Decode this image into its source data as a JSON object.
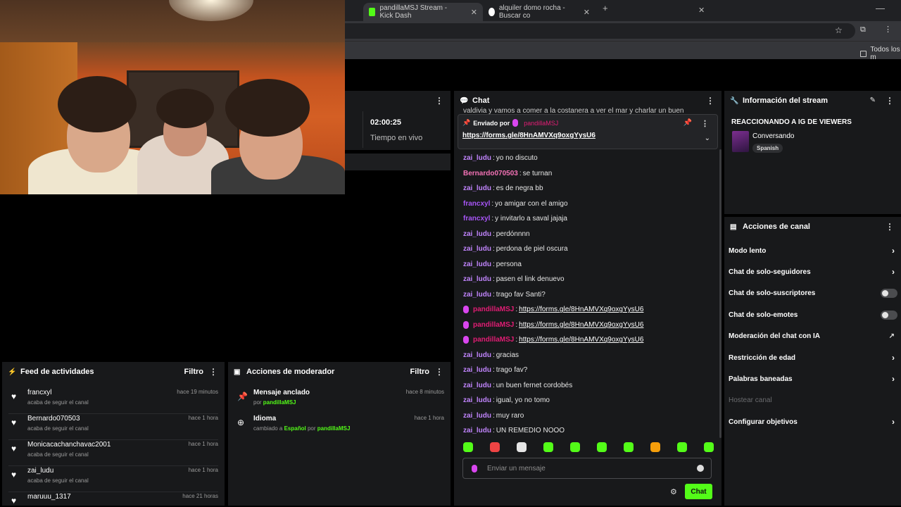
{
  "browser": {
    "tabs": [
      {
        "title": "pandillaMSJ Stream - Kick Dash",
        "active": true
      },
      {
        "title": "alquiler domo rocha - Buscar co",
        "active": false
      }
    ],
    "bookmark_all": "Todos los m"
  },
  "stats": {
    "time": "02:00:25",
    "time_label": "Tiempo en vivo"
  },
  "chat": {
    "title": "Chat",
    "overflow_line": "valdivia y vamos a comer a la costanera a ver el mar y charlar un buen",
    "pinned": {
      "label": "Enviado por",
      "user": "pandillaMSJ",
      "link": "https://forms.gle/8HnAMVXq9oxgYysU6"
    },
    "messages": [
      {
        "user": "zai_ludu",
        "color": "#c084fc",
        "text": "yo no discuto"
      },
      {
        "user": "Bernardo070503",
        "color": "#f472b6",
        "text": "se turnan"
      },
      {
        "user": "zai_ludu",
        "color": "#c084fc",
        "text": "es de negra bb"
      },
      {
        "user": "francxyl",
        "color": "#a855f7",
        "text": "yo amigar con el amigo"
      },
      {
        "user": "francxyl",
        "color": "#a855f7",
        "text": "y invitarlo a saval jajaja"
      },
      {
        "user": "zai_ludu",
        "color": "#c084fc",
        "text": "perdónnnn"
      },
      {
        "user": "zai_ludu",
        "color": "#c084fc",
        "text": "perdona de piel oscura"
      },
      {
        "user": "zai_ludu",
        "color": "#c084fc",
        "text": "persona"
      },
      {
        "user": "zai_ludu",
        "color": "#c084fc",
        "text": "pasen el link denuevo"
      },
      {
        "user": "zai_ludu",
        "color": "#c084fc",
        "text": "trago fav Santi?"
      },
      {
        "user": "pandillaMSJ",
        "color": "#e11d74",
        "text": "https://forms.gle/8HnAMVXq9oxgYysU6",
        "broadcaster": true
      },
      {
        "user": "pandillaMSJ",
        "color": "#e11d74",
        "text": "https://forms.gle/8HnAMVXq9oxgYysU6",
        "broadcaster": true
      },
      {
        "user": "pandillaMSJ",
        "color": "#e11d74",
        "text": "https://forms.gle/8HnAMVXq9oxgYysU6",
        "broadcaster": true
      },
      {
        "user": "zai_ludu",
        "color": "#c084fc",
        "text": "gracias"
      },
      {
        "user": "zai_ludu",
        "color": "#c084fc",
        "text": "trago fav?"
      },
      {
        "user": "zai_ludu",
        "color": "#c084fc",
        "text": "un buen fernet cordobés"
      },
      {
        "user": "zai_ludu",
        "color": "#c084fc",
        "text": "igual, yo no tomo"
      },
      {
        "user": "zai_ludu",
        "color": "#c084fc",
        "text": "muy raro"
      },
      {
        "user": "zai_ludu",
        "color": "#c084fc",
        "text": "UN REMEDIO NOOO"
      }
    ],
    "emote_colors": [
      "#53fc18",
      "#ef4444",
      "#e5e5e5",
      "#53fc18",
      "#53fc18",
      "#53fc18",
      "#53fc18",
      "#f59e0b",
      "#53fc18",
      "#53fc18"
    ],
    "input_placeholder": "Enviar un mensaje",
    "send_label": "Chat"
  },
  "stream_info": {
    "title": "Información del stream",
    "stream_title": "REACCIONANDO A IG DE VIEWERS",
    "category": "Conversando",
    "language": "Spanish"
  },
  "channel_actions": {
    "title": "Acciones de canal",
    "items": [
      {
        "label": "Modo lento",
        "control": "chevron"
      },
      {
        "label": "Chat de solo-seguidores",
        "control": "chevron"
      },
      {
        "label": "Chat de solo-suscriptores",
        "control": "toggle",
        "on": false
      },
      {
        "label": "Chat de solo-emotes",
        "control": "toggle",
        "on": false
      },
      {
        "label": "Moderación del chat con IA",
        "control": "external"
      },
      {
        "label": "Restricción de edad",
        "control": "chevron"
      },
      {
        "label": "Palabras baneadas",
        "control": "chevron"
      },
      {
        "label": "Hostear canal",
        "control": "none",
        "disabled": true
      },
      {
        "label": "Configurar objetivos",
        "control": "chevron"
      }
    ]
  },
  "activity_feed": {
    "title": "Feed de actividades",
    "filter": "Filtro",
    "items": [
      {
        "name": "francxyl",
        "sub": "acaba de seguir el canal",
        "time": "hace 19 minutos"
      },
      {
        "name": "Bernardo070503",
        "sub": "acaba de seguir el canal",
        "time": "hace 1 hora"
      },
      {
        "name": "Monicacachanchavac2001",
        "sub": "acaba de seguir el canal",
        "time": "hace 1 hora"
      },
      {
        "name": "zai_ludu",
        "sub": "acaba de seguir el canal",
        "time": "hace 1 hora"
      },
      {
        "name": "maruuu_1317",
        "sub": "",
        "time": "hace 21 horas"
      }
    ]
  },
  "mod_actions": {
    "title": "Acciones de moderador",
    "filter": "Filtro",
    "items": [
      {
        "name": "Mensaje anclado",
        "sub_prefix": "por",
        "sub_value": "pandillaMSJ",
        "sub_mid": "",
        "sub_value2": "",
        "time": "hace 8 minutos",
        "icon": "pin"
      },
      {
        "name": "Idioma",
        "sub_prefix": "cambiado a",
        "sub_value": "Español",
        "sub_mid": "por",
        "sub_value2": "pandillaMSJ",
        "time": "hace 1 hora",
        "icon": "globe"
      }
    ]
  }
}
